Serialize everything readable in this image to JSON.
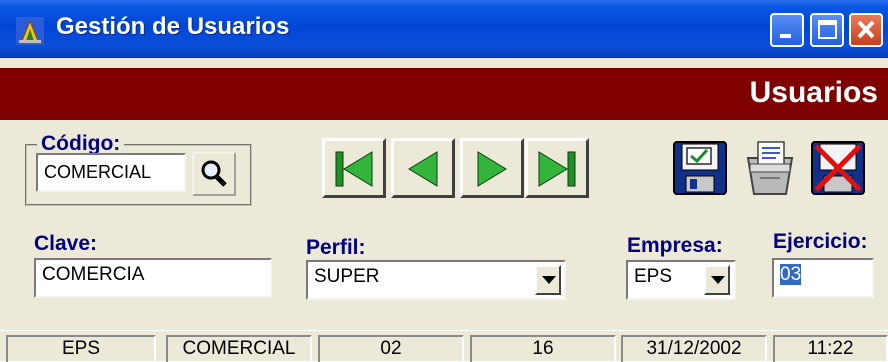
{
  "window": {
    "title": "Gestión de Usuarios",
    "controls": {
      "minimize": "minimize-icon",
      "maximize": "maximize-icon",
      "close": "close-icon"
    }
  },
  "header": {
    "title": "Usuarios"
  },
  "codigo": {
    "label": "Código:",
    "value": "COMERCIAL"
  },
  "navigation": {
    "first": "first-record-icon",
    "previous": "previous-record-icon",
    "next": "next-record-icon",
    "last": "last-record-icon"
  },
  "actions": {
    "save": "save-disk-icon",
    "print": "printer-icon",
    "delete": "delete-icon"
  },
  "form": {
    "clave": {
      "label": "Clave:",
      "value": "COMERCIA"
    },
    "perfil": {
      "label": "Perfil:",
      "value": "SUPER"
    },
    "empresa": {
      "label": "Empresa:",
      "value": "EPS"
    },
    "ejercicio": {
      "label": "Ejercicio:",
      "value": "03"
    }
  },
  "status": {
    "cells": [
      "EPS",
      "COMERCIAL",
      "02",
      "16",
      "31/12/2002",
      "11:22"
    ]
  },
  "colors": {
    "titlebar": "#0046d6",
    "header_bg": "#800000",
    "label": "#000080",
    "face": "#ece9d8",
    "nav_green": "#22a52a"
  }
}
